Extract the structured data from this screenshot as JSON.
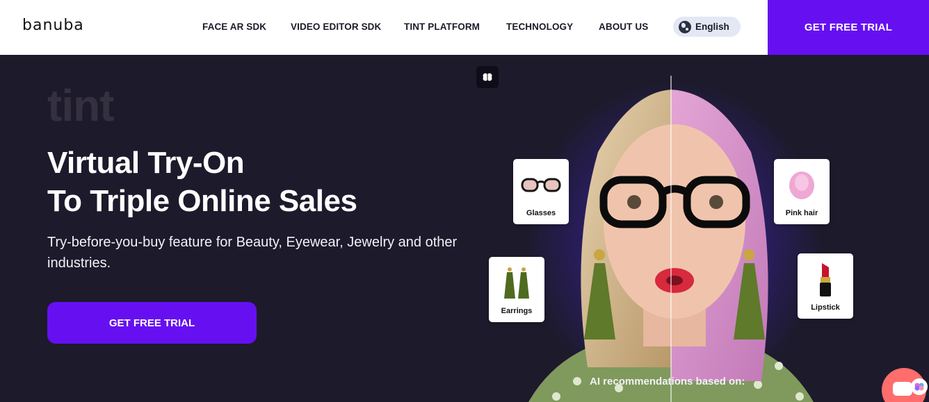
{
  "header": {
    "logo": "banuba",
    "nav": [
      {
        "label": "FACE AR SDK"
      },
      {
        "label": "VIDEO EDITOR SDK"
      },
      {
        "label": "TINT PLATFORM"
      },
      {
        "label": "TECHNOLOGY"
      },
      {
        "label": "ABOUT US"
      }
    ],
    "language": "English",
    "cta": "GET FREE TRIAL"
  },
  "hero": {
    "brand_word": "tint",
    "headline_line1": "Virtual Try-On",
    "headline_line2": "To Triple Online Sales",
    "subtext": "Try-before-you-buy feature for Beauty, Eyewear, Jewelry and other industries.",
    "cta": "GET FREE TRIAL",
    "ai_text": "AI recommendations based on:"
  },
  "cards": {
    "glasses": "Glasses",
    "earrings": "Earrings",
    "pink_hair": "Pink hair",
    "lipstick": "Lipstick"
  },
  "colors": {
    "accent": "#6610f2",
    "hero_bg": "#1d1a2b",
    "chat": "#ff6d6d"
  },
  "icons": [
    "globe-icon",
    "brain-icon",
    "chat-icon"
  ]
}
